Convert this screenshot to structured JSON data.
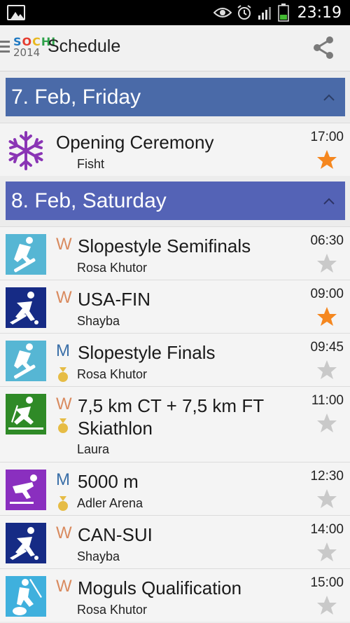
{
  "status_bar": {
    "time": "23:19",
    "icons": [
      "image-icon",
      "eye-icon",
      "alarm-icon",
      "signal-icon",
      "battery-icon"
    ]
  },
  "action_bar": {
    "title": "Schedule",
    "logo_top": "SOCHI",
    "logo_bottom": "2014",
    "menu_icon": "hamburger-icon",
    "share_icon": "share-icon"
  },
  "colors": {
    "header_friday": "#4a6aa8",
    "header_saturday": "#5463b6",
    "women": "#d98a5e",
    "men": "#3a6fa8",
    "star_on": "#f5871f",
    "star_off": "#c9c9c9",
    "medal": "#e6bc45"
  },
  "days": [
    {
      "label": "7. Feb, Friday",
      "events": [
        {
          "title": "Opening Ceremony",
          "gender": "",
          "venue": "Fisht",
          "time": "17:00",
          "starred": true,
          "medal": false,
          "sport_icon": "snowflake-icon"
        }
      ]
    },
    {
      "label": "8. Feb, Saturday",
      "events": [
        {
          "title": "Slopestyle Semifinals",
          "gender": "W",
          "venue": "Rosa Khutor",
          "time": "06:30",
          "starred": false,
          "medal": false,
          "sport_icon": "snowboard-icon"
        },
        {
          "title": "USA-FIN",
          "gender": "W",
          "venue": "Shayba",
          "time": "09:00",
          "starred": true,
          "medal": false,
          "sport_icon": "ice-hockey-icon"
        },
        {
          "title": "Slopestyle Finals",
          "gender": "M",
          "venue": "Rosa Khutor",
          "time": "09:45",
          "starred": false,
          "medal": true,
          "sport_icon": "snowboard-icon"
        },
        {
          "title_lines": [
            "7,5 km CT + 7,5 km FT",
            "Skiathlon"
          ],
          "gender": "W",
          "venue": "Laura",
          "time": "11:00",
          "starred": false,
          "medal": true,
          "sport_icon": "cross-country-icon"
        },
        {
          "title": "5000 m",
          "gender": "M",
          "venue": "Adler Arena",
          "time": "12:30",
          "starred": false,
          "medal": true,
          "sport_icon": "speed-skating-icon"
        },
        {
          "title": "CAN-SUI",
          "gender": "W",
          "venue": "Shayba",
          "time": "14:00",
          "starred": false,
          "medal": false,
          "sport_icon": "ice-hockey-icon"
        },
        {
          "title": "Moguls Qualification",
          "gender": "W",
          "venue": "Rosa Khutor",
          "time": "15:00",
          "starred": false,
          "medal": false,
          "sport_icon": "freestyle-skiing-icon"
        }
      ]
    }
  ]
}
